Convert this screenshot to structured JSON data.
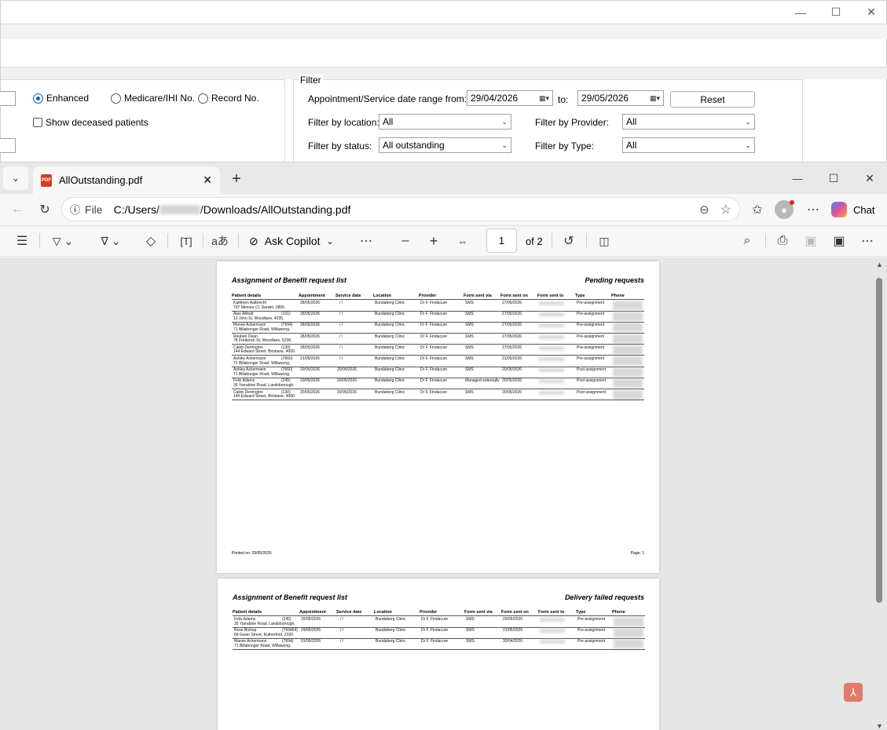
{
  "bg_app": {
    "win_controls": [
      "—",
      "☐",
      "✕"
    ],
    "search_mode": {
      "enhanced": "Enhanced",
      "medicare": "Medicare/IHI No.",
      "record": "Record No."
    },
    "show_deceased": "Show deceased patients",
    "filter": {
      "legend": "Filter",
      "date_range_label": "Appointment/Service date range from:",
      "date_from": "29/04/2026",
      "to_label": "to:",
      "date_to": "29/05/2026",
      "reset": "Reset",
      "location_label": "Filter by location:",
      "location_value": "All",
      "provider_label": "Filter by Provider:",
      "provider_value": "All",
      "status_label": "Filter by status:",
      "status_value": "All outstanding",
      "type_label": "Filter by Type:",
      "type_value": "All"
    }
  },
  "edge": {
    "tab_title": "AllOutstanding.pdf",
    "address_prefix": "File",
    "address_a": "C:/Users/",
    "address_b": "/Downloads/AllOutstanding.pdf",
    "chat_label": "Chat",
    "ask_copilot": "Ask Copilot",
    "page_number": "1",
    "page_total": "of 2"
  },
  "pdf": {
    "page1": {
      "title": "Assignment of Benefit request list",
      "subtitle": "Pending requests",
      "headers": [
        "Patient details",
        "Appointment",
        "Service date",
        "Location",
        "Provider",
        "Form sent via",
        "Form sent on",
        "Form sent to",
        "Type",
        "Phone"
      ],
      "rows": [
        {
          "name": "Kathleen Aalbrecht",
          "id": "",
          "addr": "707 Menner Cl, Darwin, 0800.",
          "appt": "28/05/2026",
          "svc": "/ /",
          "loc": "Bundaberg Clinic",
          "prov": "Dr F. Findacure",
          "via": "SMS",
          "on": "27/05/2026",
          "type": "Pre-assignment"
        },
        {
          "name": "Alan Abbott",
          "id": "(101)",
          "addr": "12 John St, Woodlane, 4035.",
          "appt": "28/05/2026",
          "svc": "/ /",
          "loc": "Bundaberg Clinic",
          "prov": "Dr F. Findacure",
          "via": "SMS",
          "on": "27/05/2026",
          "type": "Pre-assignment"
        },
        {
          "name": "Manse Ackermann",
          "id": "(7694)",
          "addr": "71 Billabonger Road, Willawong,",
          "appt": "28/05/2026",
          "svc": "/ /",
          "loc": "Bundaberg Clinic",
          "prov": "Dr F. Findacure",
          "via": "SMS",
          "on": "27/05/2026",
          "type": "Pre-assignment"
        },
        {
          "name": "Reuben Dean",
          "id": "",
          "addr": "78 Frederick St, Woodlane, 5238.",
          "appt": "28/05/2026",
          "svc": "/ /",
          "loc": "Bundaberg Clinic",
          "prov": "Dr F. Findacure",
          "via": "SMS",
          "on": "27/05/2026",
          "type": "Pre-assignment"
        },
        {
          "name": "Caleb Derrington",
          "id": "(130)",
          "addr": "144 Edward Street, Brisbane, 4000.",
          "appt": "28/05/2026",
          "svc": "/ /",
          "loc": "Bundaberg Clinic",
          "prov": "Dr F. Findacure",
          "via": "SMS",
          "on": "27/05/2026",
          "type": "Pre-assignment"
        },
        {
          "name": "Ashley Ackermann",
          "id": "(7660)",
          "addr": "71 Billabonger Road, Willawong,",
          "appt": "21/05/2026",
          "svc": "/ /",
          "loc": "Bundaberg Clinic",
          "prov": "Dr F. Findacure",
          "via": "SMS",
          "on": "21/05/2026",
          "type": "Pre-assignment"
        },
        {
          "name": "Ashley Ackermann",
          "id": "(7660)",
          "addr": "71 Billabonger Road, Willawong,",
          "appt": "20/05/2026",
          "svc": "20/05/2026",
          "loc": "Bundaberg Clinic",
          "prov": "Dr F. Findacure",
          "via": "SMS",
          "on": "20/05/2026",
          "type": "Post assignment"
        },
        {
          "name": "Felix Adams",
          "id": "(245)",
          "addr": "35 Yarrabine Road, Landsborough,",
          "appt": "20/05/2026",
          "svc": "20/05/2026",
          "loc": "Bundaberg Clinic",
          "prov": "Dr F. Findacure",
          "via": "Managed externally",
          "on": "20/05/2026",
          "type": "Post assignment"
        },
        {
          "name": "Caleb Derrington",
          "id": "(130)",
          "addr": "144 Edward Street, Brisbane, 4000.",
          "appt": "20/05/2026",
          "svc": "20/05/2026",
          "loc": "Bundaberg Clinic",
          "prov": "Dr F. Findacure",
          "via": "SMS",
          "on": "20/05/2026",
          "type": "Post assignment"
        }
      ],
      "printed_on": "Printed on: 29/05/2026",
      "page_label": "Page: 1"
    },
    "page2": {
      "title": "Assignment of Benefit request list",
      "subtitle": "Delivery failed requests",
      "headers": [
        "Patient details",
        "Appointment",
        "Service date",
        "Location",
        "Provider",
        "Form sent via",
        "Form sent on",
        "Form sent to",
        "Type",
        "Phone"
      ],
      "rows": [
        {
          "name": "Felix Adams",
          "id": "(245)",
          "addr": "35 Yarrabine Road, Landsborough,",
          "appt": "20/05/2026",
          "svc": "/ /",
          "loc": "Bundaberg Clinic",
          "prov": "Dr F. Findacure",
          "via": "SMS",
          "on": "20/05/2026",
          "type": "Pre-assignment"
        },
        {
          "name": "Rose Bishop",
          "id": "(769464)",
          "addr": "89 Gavin Street, Rutherford, 2320.",
          "appt": "19/05/2026",
          "svc": "/ /",
          "loc": "Bundaberg Clinic",
          "prov": "Dr F. Findacure",
          "via": "SMS",
          "on": "21/05/2026",
          "type": "Pre-assignment"
        },
        {
          "name": "Manse Ackermann",
          "id": "(7694)",
          "addr": "71 Billabonger Road, Willawong,",
          "appt": "01/05/2026",
          "svc": "/ /",
          "loc": "Bundaberg Clinic",
          "prov": "Dr F. Findacure",
          "via": "SMS",
          "on": "30/04/2026",
          "type": "Pre-assignment"
        }
      ]
    }
  }
}
